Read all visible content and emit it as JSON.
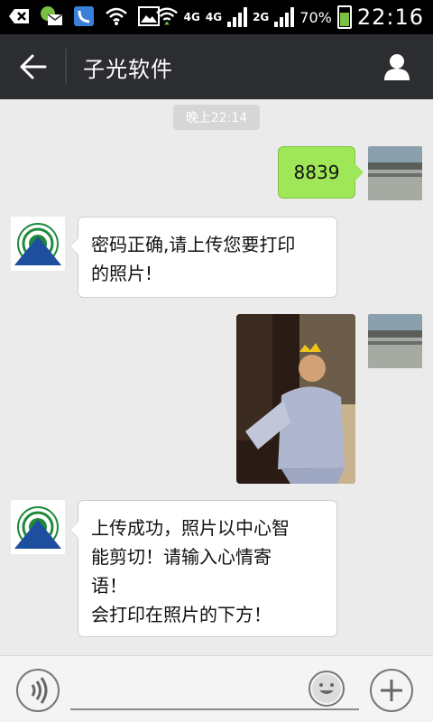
{
  "status_bar": {
    "network_4g_a": "4G",
    "network_4g_b": "4G",
    "network_2g": "2G",
    "battery_percent": "70%",
    "time": "22:16"
  },
  "header": {
    "title": "子光软件"
  },
  "chat": {
    "timestamp": "晚上22:14",
    "messages": [
      {
        "from": "me",
        "type": "text",
        "text": "8839"
      },
      {
        "from": "other",
        "type": "text",
        "lines": [
          "密码正确,请上传您要打印",
          "的照片!"
        ]
      },
      {
        "from": "me",
        "type": "image"
      },
      {
        "from": "other",
        "type": "text",
        "lines": [
          "上传成功，照片以中心智",
          "能剪切！请输入心情寄",
          "语！",
          "会打印在照片的下方！"
        ]
      }
    ]
  },
  "input_bar": {
    "placeholder": ""
  },
  "colors": {
    "title_bar": "#2b2d31",
    "chat_bg": "#ebebeb",
    "my_bubble": "#9fe658",
    "other_bubble": "#ffffff"
  },
  "icons": {
    "back": "arrow-left-icon",
    "profile": "person-icon",
    "voice": "voice-icon",
    "emoji": "smiley-icon",
    "plus": "plus-icon"
  }
}
